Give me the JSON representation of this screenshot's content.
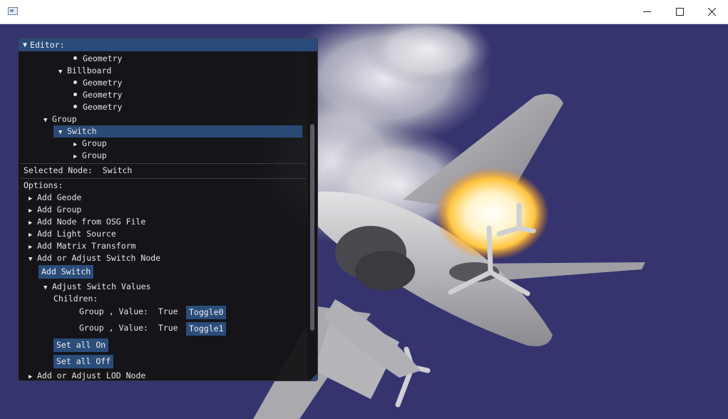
{
  "window": {
    "app_icon": "window-app-icon",
    "minimize_glyph": "—",
    "maximize_glyph": "☐",
    "close_glyph": "✕"
  },
  "editor": {
    "title": "Editor:",
    "tree": {
      "geometry_a": "Geometry",
      "billboard": "Billboard",
      "geometry_b1": "Geometry",
      "geometry_b2": "Geometry",
      "geometry_b3": "Geometry",
      "group": "Group",
      "switch": "Switch",
      "child_group_1": "Group",
      "child_group_2": "Group"
    },
    "selected_node_label": "Selected Node:",
    "selected_node_value": "Switch",
    "options_label": "Options:",
    "options": {
      "add_geode": "Add Geode",
      "add_group": "Add Group",
      "add_node_from_osg_file": "Add Node from OSG File",
      "add_light_source": "Add Light Source",
      "add_matrix_transform": "Add Matrix Transform",
      "add_or_adjust_switch_node": "Add or Adjust Switch Node",
      "add_or_adjust_lod_node": "Add or Adjust LOD Node"
    },
    "add_switch_button": "Add Switch",
    "adjust_switch_values": "Adjust Switch Values",
    "children_label": "Children:",
    "children": [
      {
        "name": "Group",
        "sep": ",",
        "value_label": "Value:",
        "value": "True",
        "toggle": "Toggle0"
      },
      {
        "name": "Group",
        "sep": ",",
        "value_label": "Value:",
        "value": "True",
        "toggle": "Toggle1"
      }
    ],
    "set_all_on": "Set all On",
    "set_all_off": "Set all Off"
  },
  "colors": {
    "background": "#35346f",
    "header": "#2a4a7a",
    "button": "#2a4d7a",
    "panel": "#121214"
  }
}
